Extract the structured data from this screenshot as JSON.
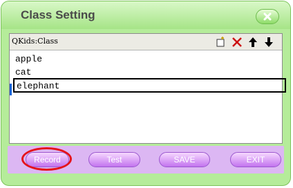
{
  "window": {
    "title": "Class Setting"
  },
  "panel": {
    "title": "QKids:Class",
    "items": [
      "apple",
      "cat",
      "elephant"
    ],
    "selected_index": 2
  },
  "toolbar": {
    "icons": [
      "new-icon",
      "delete-icon",
      "move-up-icon",
      "move-down-icon"
    ]
  },
  "buttons": {
    "record": "Record",
    "test": "Test",
    "save": "SAVE",
    "exit": "EXIT"
  },
  "colors": {
    "window_green": "#b5ec9a",
    "button_purple": "#c374ef",
    "highlight_red": "#e5131b",
    "selection_blue": "#1463d6"
  }
}
